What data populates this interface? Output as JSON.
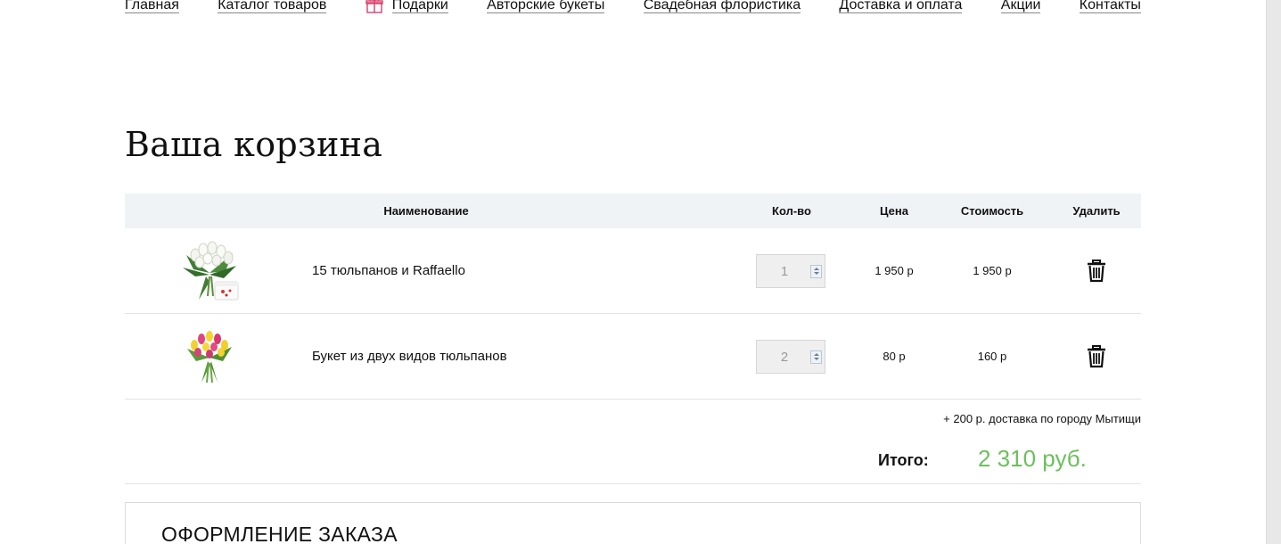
{
  "nav": {
    "items": [
      {
        "label": "Главная"
      },
      {
        "label": "Каталог товаров"
      },
      {
        "label": "Подарки",
        "icon": "gift-icon"
      },
      {
        "label": "Авторские букеты"
      },
      {
        "label": "Свадебная флористика"
      },
      {
        "label": "Доставка и оплата"
      },
      {
        "label": "Акции"
      },
      {
        "label": "Контакты"
      }
    ]
  },
  "page_title": "Ваша корзина",
  "cart": {
    "columns": {
      "name": "Наименование",
      "qty": "Кол-во",
      "price": "Цена",
      "total": "Стоимость",
      "delete": "Удалить"
    },
    "items": [
      {
        "name": "15 тюльпанов и Raffaello",
        "qty": "1",
        "price": "1 950 р",
        "total": "1 950 р",
        "thumb": "bouquet-white-tulips-raffaello-image",
        "delete_icon": "trash-icon"
      },
      {
        "name": "Букет из двух видов тюльпанов",
        "qty": "2",
        "price": "80 р",
        "total": "160 р",
        "thumb": "bouquet-mixed-tulips-image",
        "delete_icon": "trash-icon"
      }
    ],
    "delivery_note": "+ 200 р. доставка по городу Мытищи",
    "grand_total_label": "Итого:",
    "grand_total_value": "2 310 руб."
  },
  "order": {
    "title": "ОФОРМЛЕНИЕ ЗАКАЗА"
  },
  "colors": {
    "accent_green": "#6cc05c",
    "header_bg": "#f0f3f6",
    "gift_icon": "#d9416b"
  }
}
